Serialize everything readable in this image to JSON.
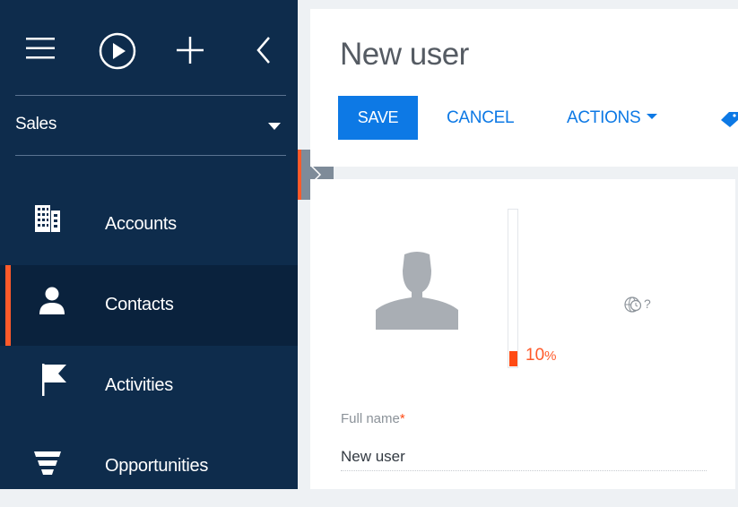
{
  "sidebar": {
    "workplace": {
      "label": "Sales"
    },
    "items": [
      {
        "label": "Accounts",
        "icon": "building-icon",
        "active": false
      },
      {
        "label": "Contacts",
        "icon": "person-icon",
        "active": true
      },
      {
        "label": "Activities",
        "icon": "flag-icon",
        "active": false
      },
      {
        "label": "Opportunities",
        "icon": "funnel-icon",
        "active": false
      }
    ]
  },
  "page": {
    "title": "New user",
    "toolbar": {
      "save_label": "SAVE",
      "cancel_label": "CANCEL",
      "actions_label": "ACTIONS"
    }
  },
  "profile": {
    "completeness": {
      "value": "10",
      "unit": "%",
      "fraction": 0.1
    },
    "timezone_marker": "?"
  },
  "form": {
    "full_name": {
      "label": "Full name",
      "required_mark": "*",
      "value": "New user"
    }
  },
  "colors": {
    "sidebar_bg": "#0e2c4c",
    "active_item_bg": "#0a223d",
    "accent_orange": "#ff5a2a",
    "primary_blue": "#0d79e5"
  }
}
